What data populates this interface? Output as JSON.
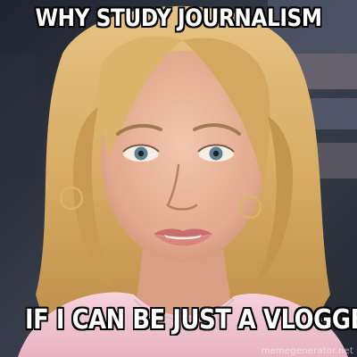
{
  "meme": {
    "top_text": "WHY STUDY JOURNALISM",
    "bottom_text": "IF I CAN BE JUST A VLOGGER",
    "watermark": "memegenerator.net"
  },
  "colors": {
    "caption_fill": "#ffffff",
    "caption_outline": "#000000",
    "hair": "#d9b06b",
    "skin": "#e7b49a",
    "top": "#f3c9d4",
    "background": "#3a3f4d"
  }
}
